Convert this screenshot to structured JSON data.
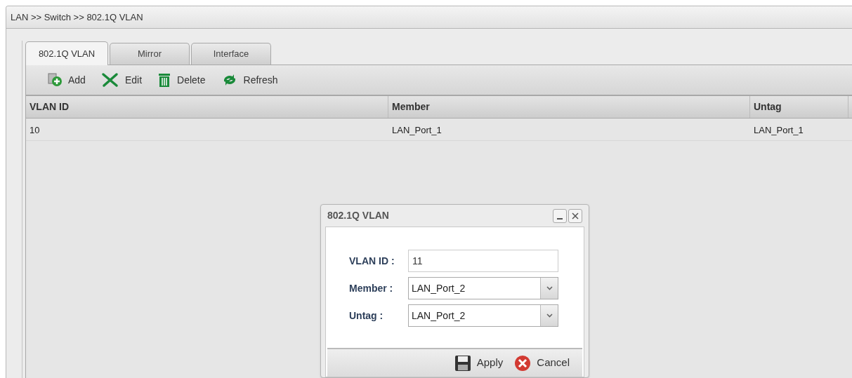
{
  "breadcrumb": "LAN >> Switch >> 802.1Q VLAN",
  "tabs": [
    {
      "label": "802.1Q VLAN",
      "selected": true
    },
    {
      "label": "Mirror",
      "selected": false
    },
    {
      "label": "Interface",
      "selected": false
    }
  ],
  "toolbar": [
    {
      "label": "Add",
      "kind": "add"
    },
    {
      "label": "Edit",
      "kind": "edit"
    },
    {
      "label": "Delete",
      "kind": "delete"
    },
    {
      "label": "Refresh",
      "kind": "refresh"
    }
  ],
  "table": {
    "columns": [
      "VLAN ID",
      "Member",
      "Untag"
    ],
    "rows": [
      [
        "10",
        "LAN_Port_1",
        "LAN_Port_1"
      ]
    ]
  },
  "dialog": {
    "title": "802.1Q VLAN",
    "fields": [
      {
        "label": "VLAN ID :",
        "kind": "text",
        "value": "11"
      },
      {
        "label": "Member :",
        "kind": "select",
        "value": "LAN_Port_2"
      },
      {
        "label": "Untag :",
        "kind": "select",
        "value": "LAN_Port_2"
      }
    ],
    "buttons": [
      {
        "label": "Apply",
        "kind": "apply"
      },
      {
        "label": "Cancel",
        "kind": "cancel"
      }
    ]
  }
}
